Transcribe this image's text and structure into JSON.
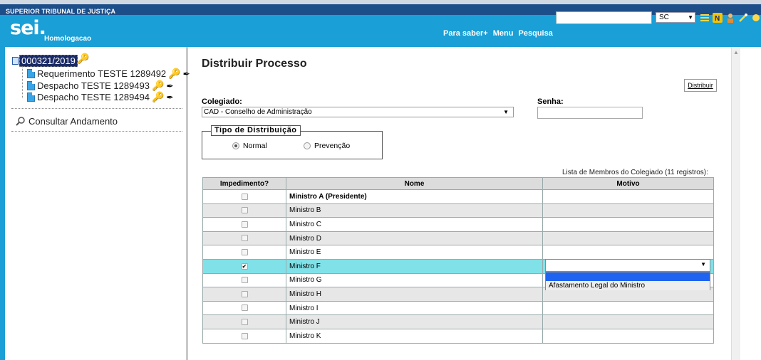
{
  "topbar": {
    "title": "SUPERIOR TRIBUNAL DE JUSTIÇA"
  },
  "header": {
    "logo": "sei.",
    "environment": "Homologacao",
    "links": [
      "Para saber+",
      "Menu",
      "Pesquisa"
    ],
    "search_value": "",
    "unit": "SC"
  },
  "tree": {
    "process": "000321/2019",
    "documents": [
      {
        "label": "Requerimento TESTE 1289492"
      },
      {
        "label": "Despacho TESTE 1289493"
      },
      {
        "label": "Despacho TESTE 1289494"
      }
    ],
    "consultar": "Consultar Andamento"
  },
  "form": {
    "title": "Distribuir Processo",
    "button": "Distribuir",
    "colegiado_label": "Colegiado:",
    "colegiado_value": "CAD - Conselho de Administração",
    "senha_label": "Senha:",
    "senha_value": "",
    "tipo_legend": "Tipo de Distribuição",
    "radio_normal": "Normal",
    "radio_prevencao": "Prevenção",
    "selected_tipo": "Normal"
  },
  "table": {
    "caption": "Lista de Membros do Colegiado (11 registros):",
    "headers": [
      "Impedimento?",
      "Nome",
      "Motivo"
    ],
    "rows": [
      {
        "nome": "Ministro A (Presidente)",
        "checked": false,
        "bold": true
      },
      {
        "nome": "Ministro B",
        "checked": false
      },
      {
        "nome": "Ministro C",
        "checked": false
      },
      {
        "nome": "Ministro D",
        "checked": false
      },
      {
        "nome": "Ministro E",
        "checked": false
      },
      {
        "nome": "Ministro F",
        "checked": true
      },
      {
        "nome": "Ministro G",
        "checked": false
      },
      {
        "nome": "Ministro H",
        "checked": false
      },
      {
        "nome": "Ministro I",
        "checked": false
      },
      {
        "nome": "Ministro J",
        "checked": false
      },
      {
        "nome": "Ministro K",
        "checked": false
      }
    ],
    "motivo_value": "",
    "motivo_options": [
      "",
      "Afastamento Legal do Ministro"
    ]
  },
  "colors": {
    "header": "#1a9fd6",
    "topbar": "#1c4f8a",
    "selected_row": "#80e2e8",
    "dropdown_highlight": "#1e64f0"
  }
}
